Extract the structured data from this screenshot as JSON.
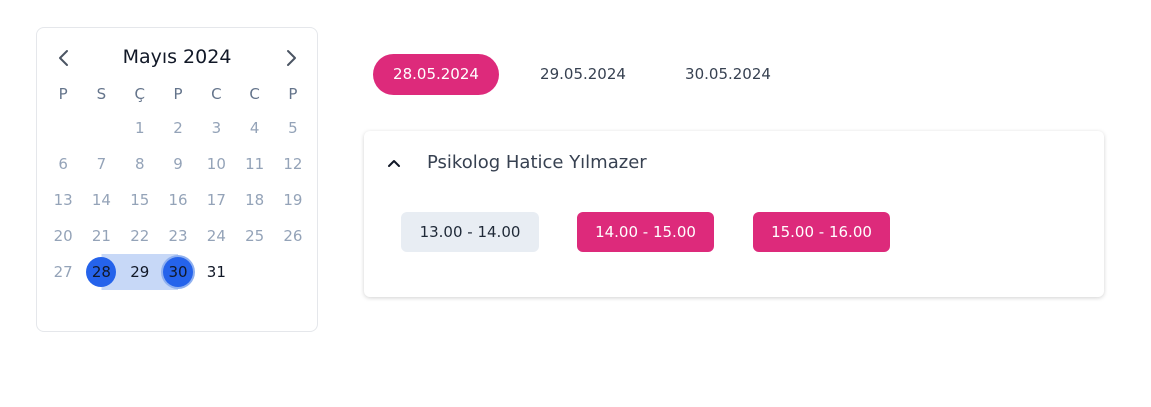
{
  "calendar": {
    "month_title": "Mayıs 2024",
    "weekdays": [
      "P",
      "S",
      "Ç",
      "P",
      "C",
      "C",
      "P"
    ],
    "weeks": [
      [
        "",
        "",
        "1",
        "2",
        "3",
        "4",
        "5"
      ],
      [
        "6",
        "7",
        "8",
        "9",
        "10",
        "11",
        "12"
      ],
      [
        "13",
        "14",
        "15",
        "16",
        "17",
        "18",
        "19"
      ],
      [
        "20",
        "21",
        "22",
        "23",
        "24",
        "25",
        "26"
      ],
      [
        "27",
        "28",
        "29",
        "30",
        "31",
        "",
        ""
      ]
    ],
    "range_start": "28",
    "range_end": "30",
    "active_days": [
      "31"
    ],
    "colors": {
      "selected": "#2563eb",
      "range": "#c7d8f7",
      "muted_day": "#94a3b8"
    }
  },
  "date_tabs": [
    {
      "label": "28.05.2024",
      "active": true
    },
    {
      "label": "29.05.2024",
      "active": false
    },
    {
      "label": "30.05.2024",
      "active": false
    }
  ],
  "panel": {
    "doctor_name": "Psikolog Hatice Yılmazer",
    "expanded": true,
    "slots": [
      {
        "label": "13.00 - 14.00",
        "available": false
      },
      {
        "label": "14.00 - 15.00",
        "available": true
      },
      {
        "label": "15.00 - 16.00",
        "available": true
      }
    ]
  },
  "colors": {
    "accent": "#dd2a7b",
    "unavailable_slot": "#e8edf3"
  }
}
